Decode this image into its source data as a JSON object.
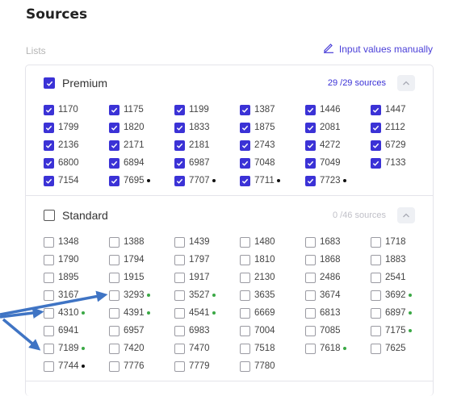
{
  "page": {
    "title": "Sources"
  },
  "lists_label": "Lists",
  "manual_link": {
    "label": "Input values manually",
    "icon": "pencil-icon"
  },
  "colors": {
    "accent": "#3b32d6",
    "green_dot": "#3aa845",
    "black_dot": "#111111",
    "arrow": "#3f74c4"
  },
  "premium": {
    "label": "Premium",
    "checked": true,
    "count": "29 /29  sources",
    "items": [
      {
        "id": "1170",
        "checked": true,
        "dot": null
      },
      {
        "id": "1175",
        "checked": true,
        "dot": null
      },
      {
        "id": "1199",
        "checked": true,
        "dot": null
      },
      {
        "id": "1387",
        "checked": true,
        "dot": null
      },
      {
        "id": "1446",
        "checked": true,
        "dot": null
      },
      {
        "id": "1447",
        "checked": true,
        "dot": null
      },
      {
        "id": "1799",
        "checked": true,
        "dot": null
      },
      {
        "id": "1820",
        "checked": true,
        "dot": null
      },
      {
        "id": "1833",
        "checked": true,
        "dot": null
      },
      {
        "id": "1875",
        "checked": true,
        "dot": null
      },
      {
        "id": "2081",
        "checked": true,
        "dot": null
      },
      {
        "id": "2112",
        "checked": true,
        "dot": null
      },
      {
        "id": "2136",
        "checked": true,
        "dot": null
      },
      {
        "id": "2171",
        "checked": true,
        "dot": null
      },
      {
        "id": "2181",
        "checked": true,
        "dot": null
      },
      {
        "id": "2743",
        "checked": true,
        "dot": null
      },
      {
        "id": "4272",
        "checked": true,
        "dot": null
      },
      {
        "id": "6729",
        "checked": true,
        "dot": null
      },
      {
        "id": "6800",
        "checked": true,
        "dot": null
      },
      {
        "id": "6894",
        "checked": true,
        "dot": null
      },
      {
        "id": "6987",
        "checked": true,
        "dot": null
      },
      {
        "id": "7048",
        "checked": true,
        "dot": null
      },
      {
        "id": "7049",
        "checked": true,
        "dot": null
      },
      {
        "id": "7133",
        "checked": true,
        "dot": null
      },
      {
        "id": "7154",
        "checked": true,
        "dot": null
      },
      {
        "id": "7695",
        "checked": true,
        "dot": "black"
      },
      {
        "id": "7707",
        "checked": true,
        "dot": "black"
      },
      {
        "id": "7711",
        "checked": true,
        "dot": "black"
      },
      {
        "id": "7723",
        "checked": true,
        "dot": "black"
      }
    ]
  },
  "standard": {
    "label": "Standard",
    "checked": false,
    "count": "0 /46 sources",
    "items": [
      {
        "id": "1348",
        "checked": false,
        "dot": null
      },
      {
        "id": "1388",
        "checked": false,
        "dot": null
      },
      {
        "id": "1439",
        "checked": false,
        "dot": null
      },
      {
        "id": "1480",
        "checked": false,
        "dot": null
      },
      {
        "id": "1683",
        "checked": false,
        "dot": null
      },
      {
        "id": "1718",
        "checked": false,
        "dot": null
      },
      {
        "id": "1790",
        "checked": false,
        "dot": null
      },
      {
        "id": "1794",
        "checked": false,
        "dot": null
      },
      {
        "id": "1797",
        "checked": false,
        "dot": null
      },
      {
        "id": "1810",
        "checked": false,
        "dot": null
      },
      {
        "id": "1868",
        "checked": false,
        "dot": null
      },
      {
        "id": "1883",
        "checked": false,
        "dot": null
      },
      {
        "id": "1895",
        "checked": false,
        "dot": null
      },
      {
        "id": "1915",
        "checked": false,
        "dot": null
      },
      {
        "id": "1917",
        "checked": false,
        "dot": null
      },
      {
        "id": "2130",
        "checked": false,
        "dot": null
      },
      {
        "id": "2486",
        "checked": false,
        "dot": null
      },
      {
        "id": "2541",
        "checked": false,
        "dot": null
      },
      {
        "id": "3167",
        "checked": false,
        "dot": null
      },
      {
        "id": "3293",
        "checked": false,
        "dot": "green"
      },
      {
        "id": "3527",
        "checked": false,
        "dot": "green"
      },
      {
        "id": "3635",
        "checked": false,
        "dot": null
      },
      {
        "id": "3674",
        "checked": false,
        "dot": null
      },
      {
        "id": "3692",
        "checked": false,
        "dot": "green"
      },
      {
        "id": "4310",
        "checked": false,
        "dot": "green"
      },
      {
        "id": "4391",
        "checked": false,
        "dot": "green"
      },
      {
        "id": "4541",
        "checked": false,
        "dot": "green"
      },
      {
        "id": "6669",
        "checked": false,
        "dot": null
      },
      {
        "id": "6813",
        "checked": false,
        "dot": null
      },
      {
        "id": "6897",
        "checked": false,
        "dot": "green"
      },
      {
        "id": "6941",
        "checked": false,
        "dot": null
      },
      {
        "id": "6957",
        "checked": false,
        "dot": null
      },
      {
        "id": "6983",
        "checked": false,
        "dot": null
      },
      {
        "id": "7004",
        "checked": false,
        "dot": null
      },
      {
        "id": "7085",
        "checked": false,
        "dot": null
      },
      {
        "id": "7175",
        "checked": false,
        "dot": "green"
      },
      {
        "id": "7189",
        "checked": false,
        "dot": "green"
      },
      {
        "id": "7420",
        "checked": false,
        "dot": null
      },
      {
        "id": "7470",
        "checked": false,
        "dot": null
      },
      {
        "id": "7518",
        "checked": false,
        "dot": null
      },
      {
        "id": "7618",
        "checked": false,
        "dot": "green"
      },
      {
        "id": "7625",
        "checked": false,
        "dot": null
      },
      {
        "id": "7744",
        "checked": false,
        "dot": "black"
      },
      {
        "id": "7776",
        "checked": false,
        "dot": null
      },
      {
        "id": "7779",
        "checked": false,
        "dot": null
      },
      {
        "id": "7780",
        "checked": false,
        "dot": null
      }
    ]
  }
}
